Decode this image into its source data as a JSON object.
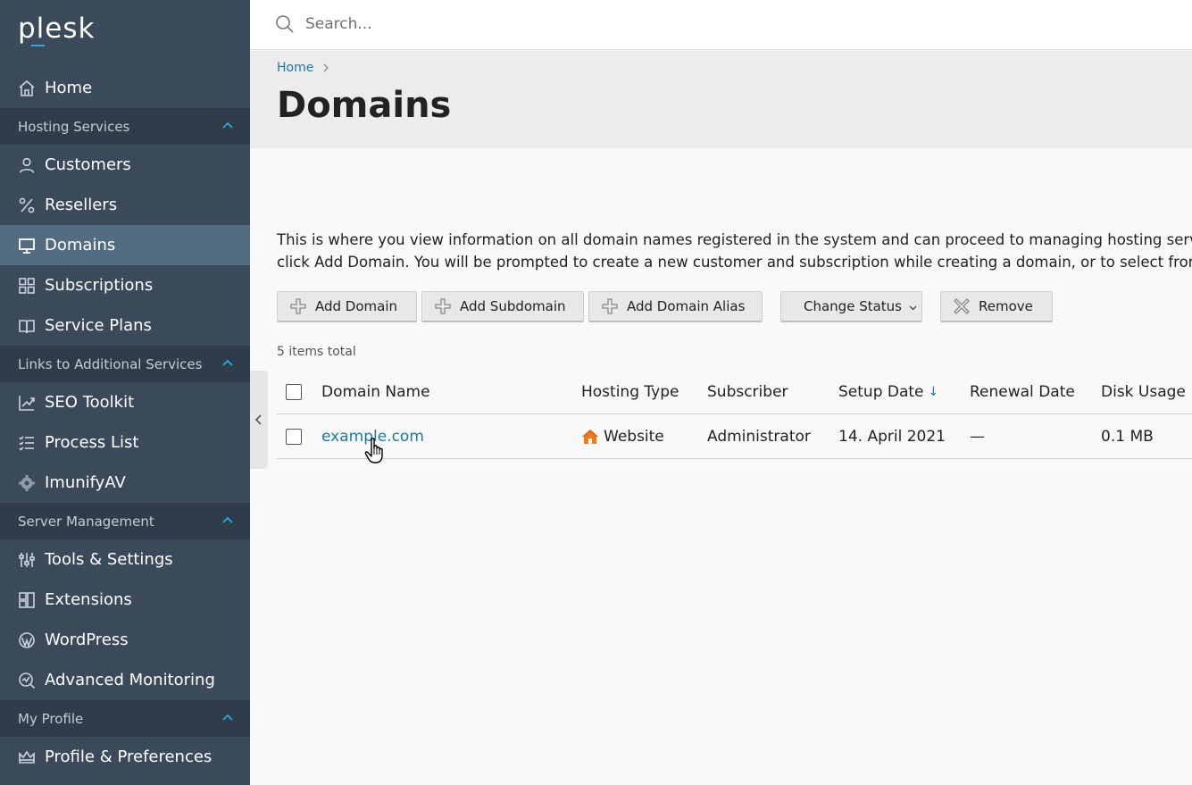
{
  "brand": {
    "logo_text": "plesk",
    "accent": "#28aade"
  },
  "search": {
    "placeholder": "Search..."
  },
  "sidebar": {
    "home": "Home",
    "sections": [
      {
        "title": "Hosting Services",
        "items": [
          "Customers",
          "Resellers",
          "Domains",
          "Subscriptions",
          "Service Plans"
        ]
      },
      {
        "title": "Links to Additional Services",
        "items": [
          "SEO Toolkit",
          "Process List",
          "ImunifyAV"
        ]
      },
      {
        "title": "Server Management",
        "items": [
          "Tools & Settings",
          "Extensions",
          "WordPress",
          "Advanced Monitoring"
        ]
      },
      {
        "title": "My Profile",
        "items": [
          "Profile & Preferences"
        ]
      }
    ],
    "active_item": "Domains"
  },
  "breadcrumb": {
    "home": "Home"
  },
  "page": {
    "title": "Domains",
    "description_line1": "This is where you view information on all domain names registered in the system and can proceed to managing hosting servic",
    "description_line2": "click Add Domain. You will be prompted to create a new customer and subscription while creating a domain, or to select from"
  },
  "toolbar": {
    "add_domain": "Add Domain",
    "add_subdomain": "Add Subdomain",
    "add_domain_alias": "Add Domain Alias",
    "change_status": "Change Status",
    "remove": "Remove"
  },
  "list": {
    "items_total": "5 items total",
    "columns": {
      "domain_name": "Domain Name",
      "hosting_type": "Hosting Type",
      "subscriber": "Subscriber",
      "setup_date": "Setup Date",
      "renewal_date": "Renewal Date",
      "disk_usage": "Disk Usage"
    },
    "sort_indicator": "↓",
    "rows": [
      {
        "domain": "example.com",
        "hosting_type": "Website",
        "subscriber": "Administrator",
        "setup_date": "14. April 2021",
        "renewal_date": "—",
        "disk_usage": "0.1 MB"
      }
    ]
  }
}
